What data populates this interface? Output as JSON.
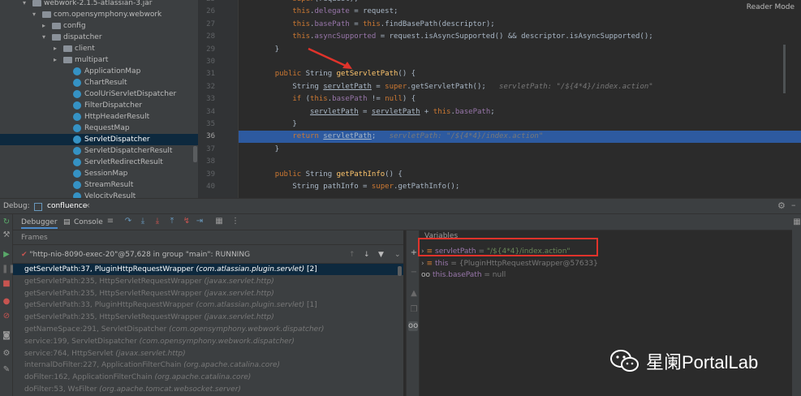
{
  "project_tree": {
    "items": [
      {
        "label": "webwork-2.1.5-atlassian-3.jar",
        "type": "jar",
        "indent": 40,
        "arrow": "▾"
      },
      {
        "label": "com.opensymphony.webwork",
        "type": "folder",
        "indent": 52,
        "arrow": "▾"
      },
      {
        "label": "config",
        "type": "folder",
        "indent": 64,
        "arrow": "▸"
      },
      {
        "label": "dispatcher",
        "type": "folder",
        "indent": 64,
        "arrow": "▾"
      },
      {
        "label": "client",
        "type": "folder",
        "indent": 78,
        "arrow": "▸"
      },
      {
        "label": "multipart",
        "type": "folder",
        "indent": 78,
        "arrow": "▸"
      },
      {
        "label": "ApplicationMap",
        "type": "class",
        "indent": 90
      },
      {
        "label": "ChartResult",
        "type": "class",
        "indent": 90
      },
      {
        "label": "CoolUriServletDispatcher",
        "type": "class",
        "indent": 90
      },
      {
        "label": "FilterDispatcher",
        "type": "class",
        "indent": 90
      },
      {
        "label": "HttpHeaderResult",
        "type": "class",
        "indent": 90
      },
      {
        "label": "RequestMap",
        "type": "class",
        "indent": 90
      },
      {
        "label": "ServletDispatcher",
        "type": "class",
        "indent": 90,
        "selected": true
      },
      {
        "label": "ServletDispatcherResult",
        "type": "class",
        "indent": 90
      },
      {
        "label": "ServletRedirectResult",
        "type": "class",
        "indent": 90
      },
      {
        "label": "SessionMap",
        "type": "class",
        "indent": 90
      },
      {
        "label": "StreamResult",
        "type": "class",
        "indent": 90
      },
      {
        "label": "VelocityResult",
        "type": "class",
        "indent": 90
      }
    ]
  },
  "editor": {
    "reader_mode": "Reader Mode",
    "lines": [
      {
        "n": "25",
        "segs": [
          [
            "        ",
            ""
          ],
          [
            "super",
            "kw"
          ],
          [
            "(request);",
            ""
          ]
        ]
      },
      {
        "n": "26",
        "segs": [
          [
            "        ",
            ""
          ],
          [
            "this",
            "kw"
          ],
          [
            ".",
            ""
          ],
          [
            "delegate",
            "fd"
          ],
          [
            " = request;",
            ""
          ]
        ]
      },
      {
        "n": "27",
        "segs": [
          [
            "        ",
            ""
          ],
          [
            "this",
            "kw"
          ],
          [
            ".",
            ""
          ],
          [
            "basePath",
            "fd"
          ],
          [
            " = ",
            ""
          ],
          [
            "this",
            "kw"
          ],
          [
            ".findBasePath(descriptor);",
            ""
          ]
        ]
      },
      {
        "n": "28",
        "segs": [
          [
            "        ",
            ""
          ],
          [
            "this",
            "kw"
          ],
          [
            ".",
            ""
          ],
          [
            "asyncSupported",
            "fd"
          ],
          [
            " = request.isAsyncSupported() && descriptor.isAsyncSupported();",
            ""
          ]
        ]
      },
      {
        "n": "29",
        "segs": [
          [
            "    }",
            ""
          ]
        ]
      },
      {
        "n": "30",
        "segs": [
          [
            "",
            ""
          ]
        ]
      },
      {
        "n": "31",
        "segs": [
          [
            "    ",
            ""
          ],
          [
            "public",
            "kw"
          ],
          [
            " String ",
            ""
          ],
          [
            "getServletPath",
            "fn"
          ],
          [
            "() {",
            ""
          ]
        ]
      },
      {
        "n": "32",
        "segs": [
          [
            "        String ",
            ""
          ],
          [
            "servletPath",
            "ul"
          ],
          [
            " = ",
            ""
          ],
          [
            "super",
            "kw"
          ],
          [
            ".getServletPath();   ",
            ""
          ],
          [
            "servletPath: \"/${4*4}/index.action\"",
            "cm"
          ]
        ]
      },
      {
        "n": "33",
        "segs": [
          [
            "        ",
            ""
          ],
          [
            "if",
            "kw"
          ],
          [
            " (",
            ""
          ],
          [
            "this",
            "kw"
          ],
          [
            ".",
            ""
          ],
          [
            "basePath",
            "fd"
          ],
          [
            " != ",
            ""
          ],
          [
            "null",
            "kw"
          ],
          [
            ") {",
            ""
          ]
        ]
      },
      {
        "n": "34",
        "segs": [
          [
            "            ",
            ""
          ],
          [
            "servletPath",
            "ul"
          ],
          [
            " = ",
            ""
          ],
          [
            "servletPath",
            "ul"
          ],
          [
            " + ",
            ""
          ],
          [
            "this",
            "kw"
          ],
          [
            ".",
            ""
          ],
          [
            "basePath",
            "fd"
          ],
          [
            ";",
            ""
          ]
        ]
      },
      {
        "n": "35",
        "segs": [
          [
            "        }",
            ""
          ]
        ]
      },
      {
        "n": "36",
        "segs": [
          [
            "        ",
            ""
          ],
          [
            "return",
            "kw"
          ],
          [
            " ",
            ""
          ],
          [
            "servletPath",
            "ul"
          ],
          [
            ";   ",
            ""
          ],
          [
            "servletPath: \"/${4*4}/index.action\"",
            "cm"
          ]
        ],
        "hl": true
      },
      {
        "n": "37",
        "segs": [
          [
            "    }",
            ""
          ]
        ]
      },
      {
        "n": "38",
        "segs": [
          [
            "",
            ""
          ]
        ]
      },
      {
        "n": "39",
        "segs": [
          [
            "    ",
            ""
          ],
          [
            "public",
            "kw"
          ],
          [
            " String ",
            ""
          ],
          [
            "getPathInfo",
            "fn"
          ],
          [
            "() {",
            ""
          ]
        ]
      },
      {
        "n": "40",
        "segs": [
          [
            "        String pathInfo = ",
            ""
          ],
          [
            "super",
            "kw"
          ],
          [
            ".getPathInfo();",
            ""
          ]
        ]
      }
    ]
  },
  "debug_bar": {
    "label": "Debug:",
    "config": "confluence"
  },
  "toolbar": {
    "tab_debugger": "Debugger",
    "tab_console": "Console"
  },
  "frames": {
    "header": "Frames",
    "thread": "\"http-nio-8090-exec-20\"@57,628 in group \"main\": RUNNING",
    "items": [
      {
        "m": "getServletPath:37, PluginHttpRequestWrapper ",
        "p": "(com.atlassian.plugin.servlet)",
        "s": " [2]",
        "selected": true
      },
      {
        "m": "getServletPath:235, HttpServletRequestWrapper ",
        "p": "(javax.servlet.http)",
        "s": ""
      },
      {
        "m": "getServletPath:235, HttpServletRequestWrapper ",
        "p": "(javax.servlet.http)",
        "s": ""
      },
      {
        "m": "getServletPath:33, PluginHttpRequestWrapper ",
        "p": "(com.atlassian.plugin.servlet)",
        "s": " [1]"
      },
      {
        "m": "getServletPath:235, HttpServletRequestWrapper ",
        "p": "(javax.servlet.http)",
        "s": ""
      },
      {
        "m": "getNameSpace:291, ServletDispatcher ",
        "p": "(com.opensymphony.webwork.dispatcher)",
        "s": ""
      },
      {
        "m": "service:199, ServletDispatcher ",
        "p": "(com.opensymphony.webwork.dispatcher)",
        "s": ""
      },
      {
        "m": "service:764, HttpServlet ",
        "p": "(javax.servlet.http)",
        "s": ""
      },
      {
        "m": "internalDoFilter:227, ApplicationFilterChain ",
        "p": "(org.apache.catalina.core)",
        "s": ""
      },
      {
        "m": "doFilter:162, ApplicationFilterChain ",
        "p": "(org.apache.catalina.core)",
        "s": ""
      },
      {
        "m": "doFilter:53, WsFilter ",
        "p": "(org.apache.tomcat.websocket.server)",
        "s": ""
      }
    ]
  },
  "variables": {
    "header": "Variables",
    "items": [
      {
        "name": "servletPath",
        "eq": " = ",
        "val": "\"/${4*4}/index.action\"",
        "icon": "≡"
      },
      {
        "name": "this",
        "eq": " = ",
        "val": "{PluginHttpRequestWrapper@57633}",
        "icon": "≡"
      },
      {
        "name": "this.basePath",
        "eq": " = ",
        "val": "null",
        "icon": "oo"
      }
    ]
  },
  "watermark": {
    "text": "星阑PortalLab"
  }
}
